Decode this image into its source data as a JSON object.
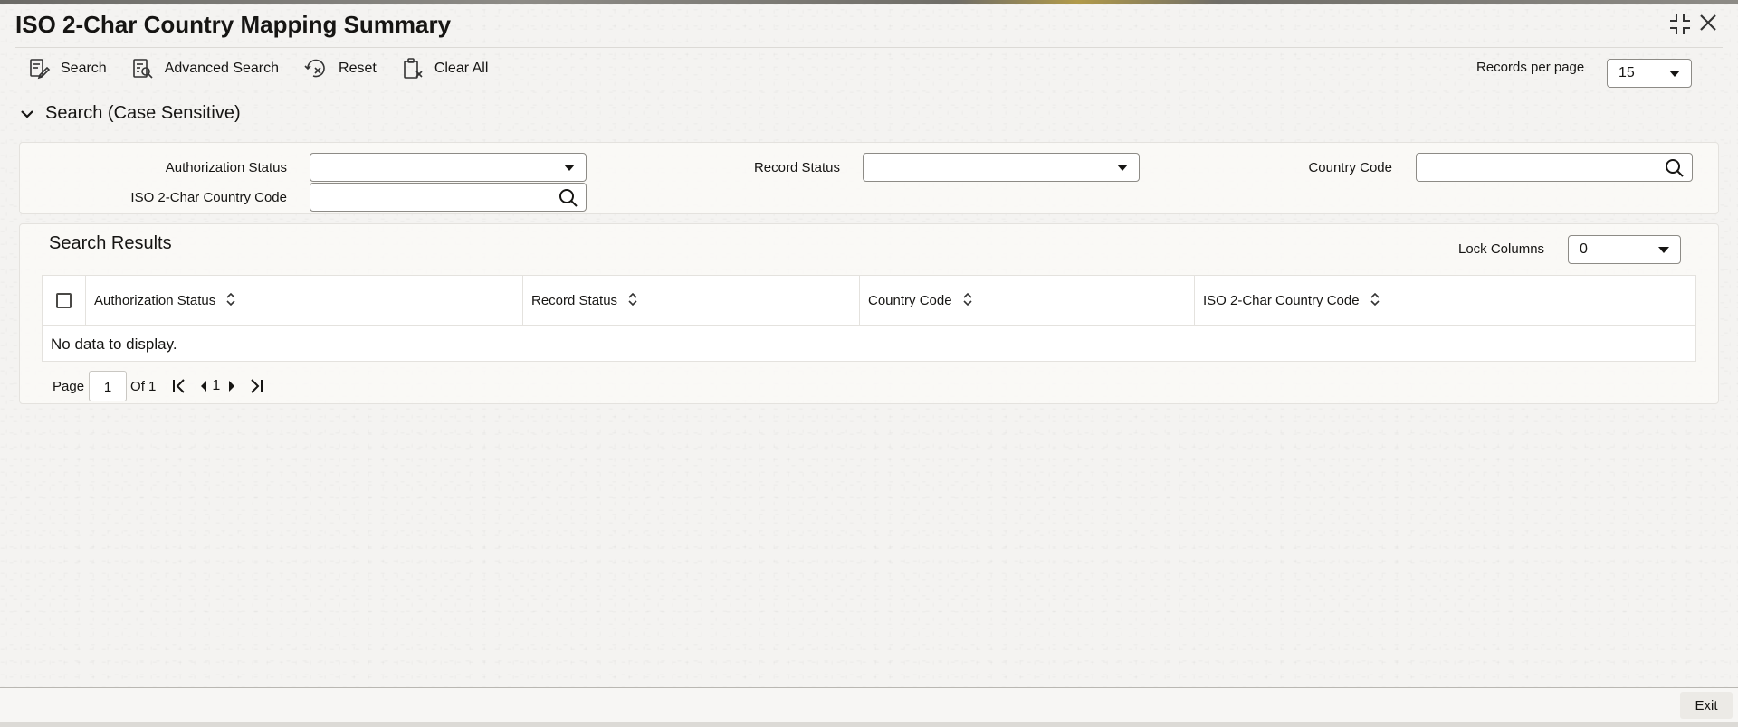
{
  "window": {
    "title": "ISO 2-Char Country Mapping Summary"
  },
  "toolbar": {
    "search_label": "Search",
    "advanced_search_label": "Advanced Search",
    "reset_label": "Reset",
    "clear_all_label": "Clear All",
    "records_per_page_label": "Records per page",
    "records_per_page_value": "15"
  },
  "search_section": {
    "heading": "Search (Case Sensitive)",
    "fields": {
      "authorization_status": {
        "label": "Authorization Status",
        "value": ""
      },
      "record_status": {
        "label": "Record Status",
        "value": ""
      },
      "country_code": {
        "label": "Country Code",
        "value": ""
      },
      "iso_country_code": {
        "label": "ISO 2-Char Country Code",
        "value": ""
      }
    }
  },
  "results": {
    "title": "Search Results",
    "lock_columns_label": "Lock Columns",
    "lock_columns_value": "0",
    "columns": [
      "Authorization Status",
      "Record Status",
      "Country Code",
      "ISO 2-Char Country Code"
    ],
    "rows": [],
    "empty_message": "No data to display."
  },
  "pagination": {
    "page_label": "Page",
    "current_page": "1",
    "of_label": "Of 1",
    "page_number": "1"
  },
  "footer": {
    "exit_label": "Exit"
  },
  "icons": {
    "search": "search-icon",
    "advanced_search": "advanced-search-icon",
    "reset": "reset-icon",
    "clear_all": "clear-all-icon",
    "lookup": "magnifier-icon",
    "collapse": "chevron-down-icon",
    "sort": "sort-icon",
    "minimize": "collapse-window-icon",
    "close": "close-icon"
  },
  "colors": {
    "text": "#161513",
    "border": "#8d8b86",
    "background": "#f4f3f1"
  }
}
